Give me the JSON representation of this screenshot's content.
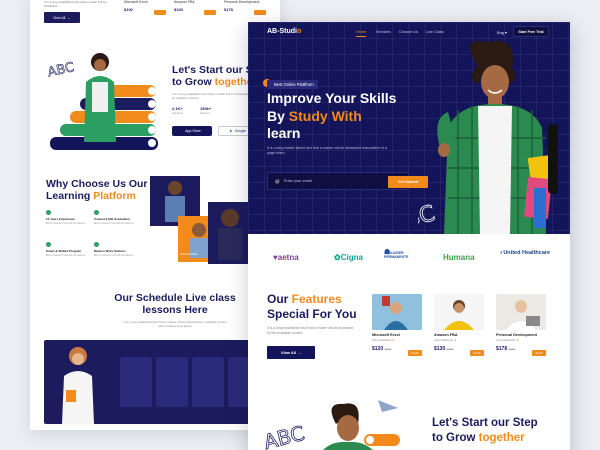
{
  "bg_page": {
    "top_cards": [
      {
        "title": "Microsoft Excel",
        "price": "$100"
      },
      {
        "title": "Amazon FBA",
        "price": "$100"
      },
      {
        "title": "Personal Development",
        "price": "$178"
      }
    ],
    "view_all": "View All",
    "step_title_1": "Let's Start our St",
    "step_title_2a": "to Grow ",
    "step_title_2b": "togethe",
    "step_stats": [
      {
        "value": "2.1K+",
        "label": "Students"
      },
      {
        "value": "150k+",
        "label": "Student"
      }
    ],
    "app_store": "App Store",
    "google": "Google",
    "why_title_1": "Why Choose Us Our",
    "why_title_2a": "Learning ",
    "why_title_2b": "Platform",
    "why_items": [
      {
        "title": "10 Years Experience"
      },
      {
        "title": "Trusted 3,000 Graduation"
      },
      {
        "title": "Smart & Skilled Program"
      },
      {
        "title": "Modern Work Stations"
      }
    ],
    "schedule_title_1": "Our Schedule Live class",
    "schedule_title_2": "lessons Here",
    "mentor_name": "Steve Philips"
  },
  "nav": {
    "logo_main": "AB-Studi",
    "logo_accent": "o",
    "links": [
      "Home",
      "Services",
      "Choose Us",
      "Live Class"
    ],
    "lang": "Eng",
    "trial_button": "Start Free Trial"
  },
  "hero": {
    "tag": "Best Online Plattfrom",
    "title_1": "Improve Your Skills",
    "title_2a": "By ",
    "title_2b": "Study With",
    "title_3": "learn",
    "subtitle": "It is a long establi lished fact that a reader will be distracted reaconttent of a page when",
    "email_placeholder": "Enter your email",
    "cta": "Get Started",
    "abc": "ABC"
  },
  "partners": [
    "aetna",
    "Cigna",
    "KAISER PERMANENTE",
    "Humana",
    "United Healthcare"
  ],
  "features": {
    "title_1a": "Our ",
    "title_1b": "Features",
    "title_2": "Special For You",
    "subtitle": "It is a long established fact that a reader will be distracted by the readable content",
    "view_all": "View All",
    "cards": [
      {
        "title": "Microsoft Excel",
        "meta": "Anne Matthews",
        "price": "$120",
        "old": "$100",
        "btn": "Enroll"
      },
      {
        "title": "Amazon FBA",
        "meta": "Anne Matthews",
        "price": "$130",
        "old": "$100",
        "btn": "Enroll"
      },
      {
        "title": "Personal Development",
        "meta": "Anne Matthews",
        "price": "$178",
        "old": "$100",
        "btn": "Enroll"
      }
    ]
  },
  "step": {
    "title_1": "Let's Start our Step",
    "title_2a": "to Grow ",
    "title_2b": "together"
  },
  "colors": {
    "navy": "#14145a",
    "orange": "#f28a1c",
    "green": "#2b9e62"
  }
}
